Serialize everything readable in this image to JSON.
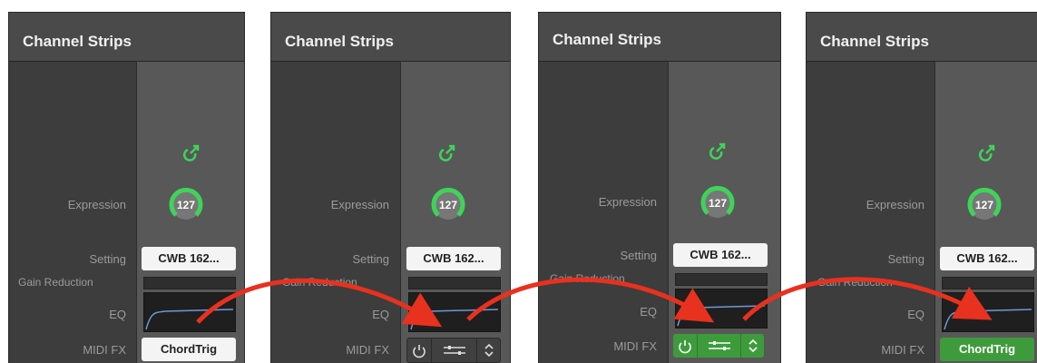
{
  "panels": [
    {
      "title": "Channel Strips",
      "labels": {
        "expression": "Expression",
        "setting": "Setting",
        "gain_reduction": "Gain Reduction",
        "eq": "EQ",
        "midi_fx": "MIDI FX"
      },
      "knob_value": "127",
      "setting_value": "CWB 162...",
      "midi_fx_state": "ChordTrig"
    },
    {
      "title": "Channel Strips",
      "labels": {
        "expression": "Expression",
        "setting": "Setting",
        "gain_reduction": "Gain Reduction",
        "eq": "EQ",
        "midi_fx": "MIDI FX"
      },
      "knob_value": "127",
      "setting_value": "CWB 162...",
      "midi_fx_state": "hover-controls-gray"
    },
    {
      "title": "Channel Strips",
      "labels": {
        "expression": "Expression",
        "setting": "Setting",
        "gain_reduction": "Gain Reduction",
        "eq": "EQ",
        "midi_fx": "MIDI FX"
      },
      "knob_value": "127",
      "setting_value": "CWB 162...",
      "midi_fx_state": "hover-controls-green"
    },
    {
      "title": "Channel Strips",
      "labels": {
        "expression": "Expression",
        "setting": "Setting",
        "gain_reduction": "Gain Reduction",
        "eq": "EQ",
        "midi_fx": "MIDI FX"
      },
      "knob_value": "127",
      "setting_value": "CWB 162...",
      "midi_fx_state": "ChordTrig"
    }
  ],
  "colors": {
    "arrow": "#e8311e",
    "knob_ring": "#3fd35a",
    "io_icon": "#3fd35a",
    "midi_green": "#3e9b3c",
    "eq_curve": "#6f97d8"
  },
  "icons": [
    "io-arrow-icon",
    "power-icon",
    "sliders-icon",
    "updown-chevron-icon"
  ]
}
